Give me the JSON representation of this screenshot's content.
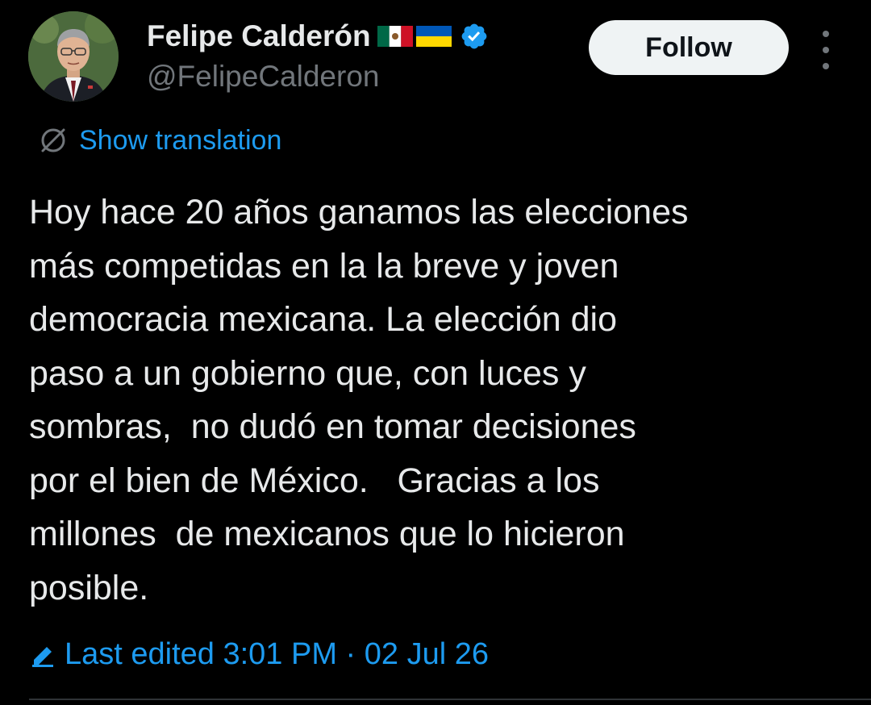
{
  "tweet": {
    "author": {
      "display_name": "Felipe Calderón",
      "handle": "@FelipeCalderon",
      "flags": [
        "mexico-flag-icon",
        "ukraine-flag-icon"
      ],
      "verified_icon": "verified-badge-icon"
    },
    "follow_label": "Follow",
    "more_icon": "more-vertical-icon",
    "translation_label": "Show translation",
    "translation_icon": "globe-translate-icon",
    "body": "Hoy hace 20 años ganamos las elecciones\nmás competidas en la la breve y joven\ndemocracia mexicana. La elección dio\npaso a un gobierno que, con luces y\nsombras,  no dudó en tomar decisiones\npor el bien de México.   Gracias a los\nmillones  de mexicanos que lo hicieron\nposible.",
    "edited_label": "Last edited 3:01 PM · 02 Jul 26",
    "edited_icon": "pencil-edit-icon"
  },
  "colors": {
    "background": "#000000",
    "text_primary": "#e7e9ea",
    "text_secondary": "#71767b",
    "accent_blue": "#1d9bf0",
    "follow_bg": "#eff3f4",
    "divider": "#2f3336"
  }
}
